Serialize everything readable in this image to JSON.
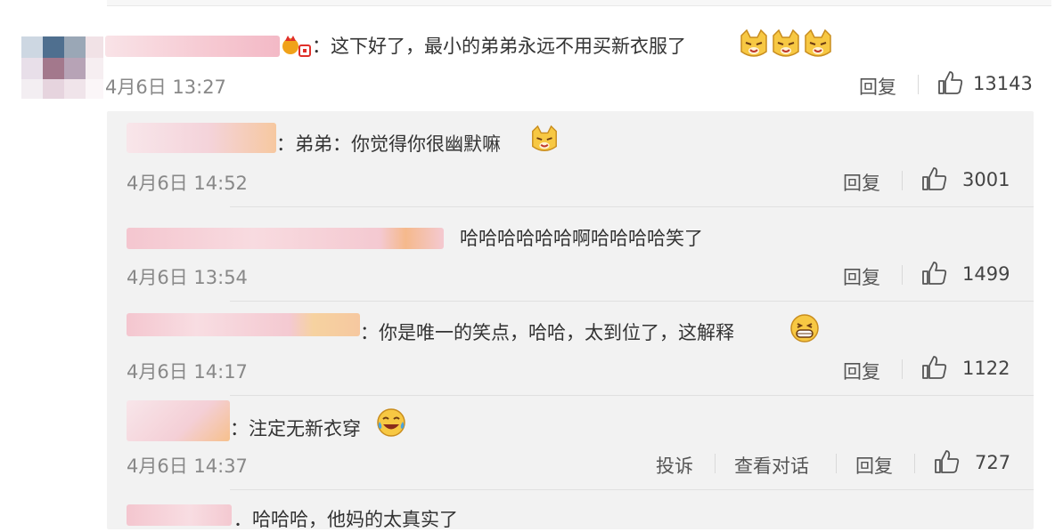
{
  "main_comment": {
    "text": "：这下好了，最小的弟弟永远不用买新衣服了",
    "time": "4月6日 13:27",
    "reply_label": "回复",
    "likes": "13143",
    "emoji": "dog-face-emoji"
  },
  "replies": [
    {
      "text": "：弟弟：你觉得你很幽默嘛",
      "time": "4月6日 14:52",
      "reply_label": "回复",
      "likes": "3001"
    },
    {
      "text": "哈哈哈哈哈哈啊哈哈哈哈笑了",
      "time": "4月6日 13:54",
      "reply_label": "回复",
      "likes": "1499"
    },
    {
      "text": "：你是唯一的笑点，哈哈，太到位了，这解释",
      "time": "4月6日 14:17",
      "reply_label": "回复",
      "likes": "1122"
    },
    {
      "text": "：注定无新衣穿",
      "time": "4月6日 14:37",
      "report_label": "投诉",
      "view_conversation_label": "查看对话",
      "reply_label": "回复",
      "likes": "727"
    },
    {
      "text": "．哈哈哈，他妈的太真实了"
    }
  ],
  "colors": {
    "emoji_yellow": "#f7c843",
    "blur_pink": "#f6d1d6",
    "blur_orange": "#f5c08c"
  }
}
